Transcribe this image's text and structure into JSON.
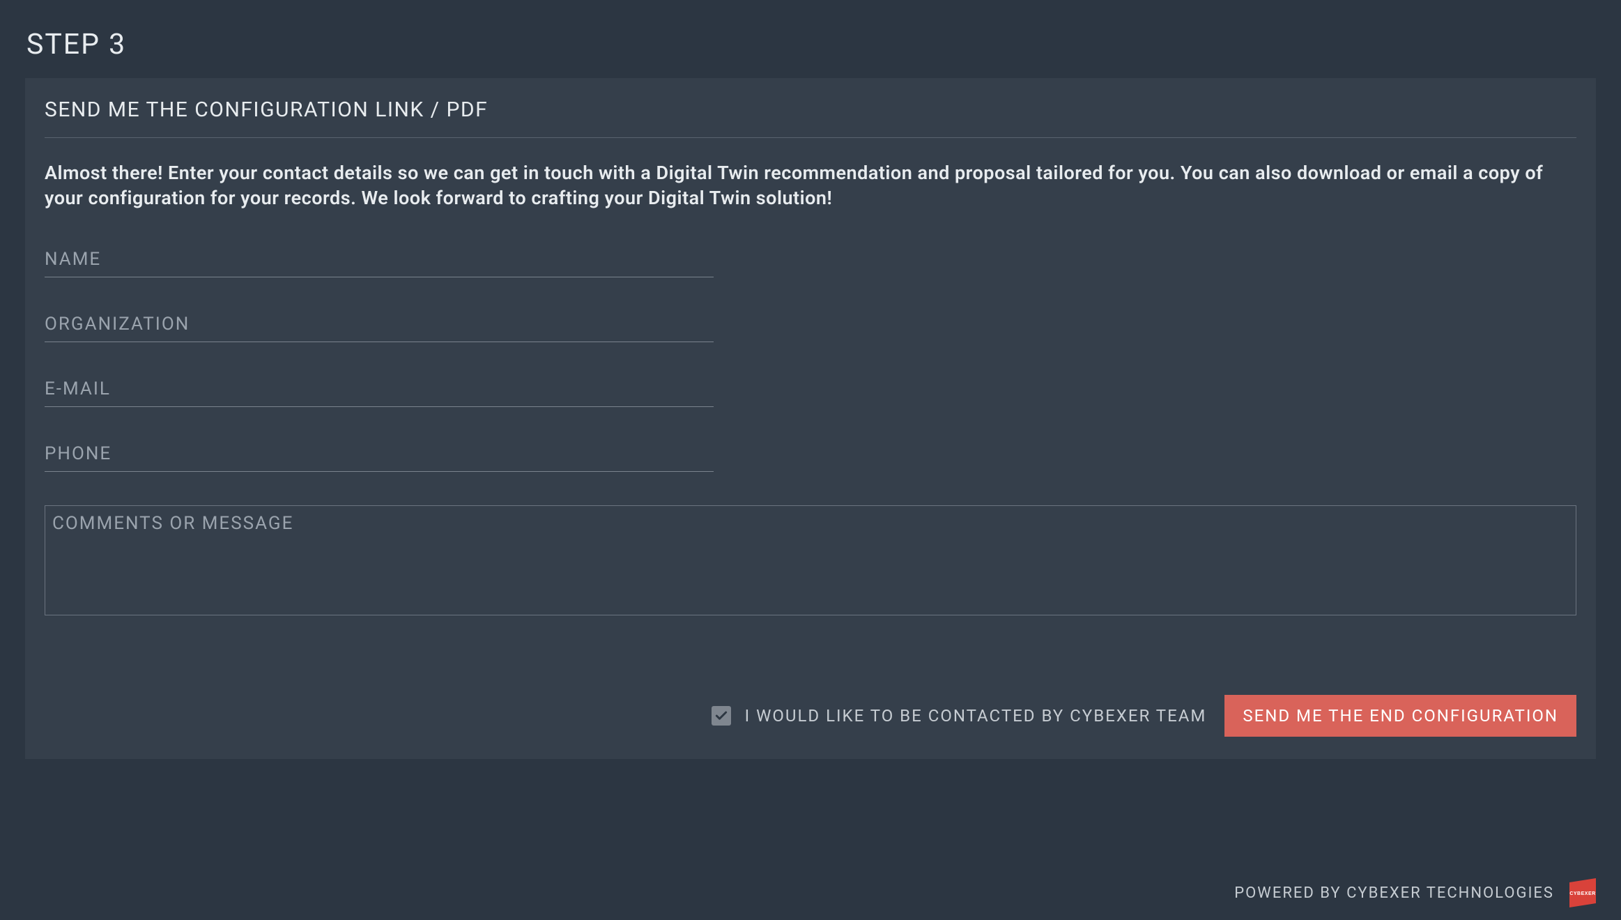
{
  "header": {
    "step_title": "STEP 3"
  },
  "panel": {
    "heading": "SEND ME THE CONFIGURATION LINK / PDF",
    "description": "Almost there! Enter your contact details so we can get in touch with a Digital Twin recommendation and proposal tailored for you. You can also download or email a copy of your configuration for your records. We look forward to crafting your Digital Twin solution!"
  },
  "form": {
    "name_placeholder": "NAME",
    "name_value": "",
    "organization_placeholder": "ORGANIZATION",
    "organization_value": "",
    "email_placeholder": "E-MAIL",
    "email_value": "",
    "phone_placeholder": "PHONE",
    "phone_value": "",
    "comments_placeholder": "COMMENTS OR MESSAGE",
    "comments_value": "",
    "checkbox_label": "I WOULD LIKE TO BE CONTACTED BY CYBEXER TEAM",
    "checkbox_checked": true,
    "submit_label": "SEND ME THE END CONFIGURATION"
  },
  "footer": {
    "powered_by": "POWERED BY CYBEXER TECHNOLOGIES",
    "logo_name": "CYBEXER"
  }
}
